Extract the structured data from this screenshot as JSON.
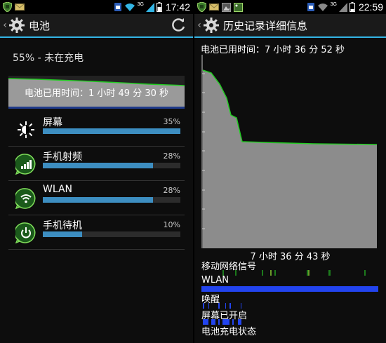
{
  "left": {
    "status_bar": {
      "time": "17:42",
      "network": "3G",
      "icons": [
        "shield-icon",
        "envelope-icon",
        "sim-icon",
        "wifi-icon",
        "signal-icon",
        "battery-icon"
      ]
    },
    "action_bar": {
      "title": "电池",
      "icons": [
        "back-caret-icon",
        "settings-gear-icon",
        "refresh-icon"
      ]
    },
    "status_text": "55% - 未在充电",
    "graph": {
      "used_time_label": "电池已用时间：1 小时 49 分 30 秒"
    },
    "usage": [
      {
        "name": "屏幕",
        "percent_label": "35%",
        "percent": 35,
        "icon": "brightness-icon"
      },
      {
        "name": "手机射频",
        "percent_label": "28%",
        "percent": 28,
        "icon": "cell-signal-icon"
      },
      {
        "name": "WLAN",
        "percent_label": "28%",
        "percent": 28,
        "icon": "wifi-icon"
      },
      {
        "name": "手机待机",
        "percent_label": "10%",
        "percent": 10,
        "icon": "power-icon"
      }
    ]
  },
  "right": {
    "status_bar": {
      "time": "22:59",
      "network": "3G",
      "icons": [
        "shield-icon",
        "envelope-icon",
        "image-icon",
        "picture-icon",
        "sim-icon",
        "wifi-icon",
        "signal-icon",
        "battery-icon"
      ]
    },
    "action_bar": {
      "title": "历史记录详细信息",
      "icons": [
        "back-caret-icon",
        "settings-gear-icon"
      ]
    },
    "used_time": "电池已用时间：7 小时 36 分 52 秒",
    "duration_label": "7 小时 36 分 43 秒",
    "strips": {
      "mobile_signal": "移动网络信号",
      "wlan": "WLAN",
      "awake": "唤醒",
      "screen_on": "屏幕已开启",
      "charging": "电池充电状态"
    },
    "colors": {
      "graph_line": "#22cc22",
      "graph_fill": "#8c8c8c",
      "strip_blue": "#2244ee",
      "accent": "#33b5e5"
    }
  }
}
